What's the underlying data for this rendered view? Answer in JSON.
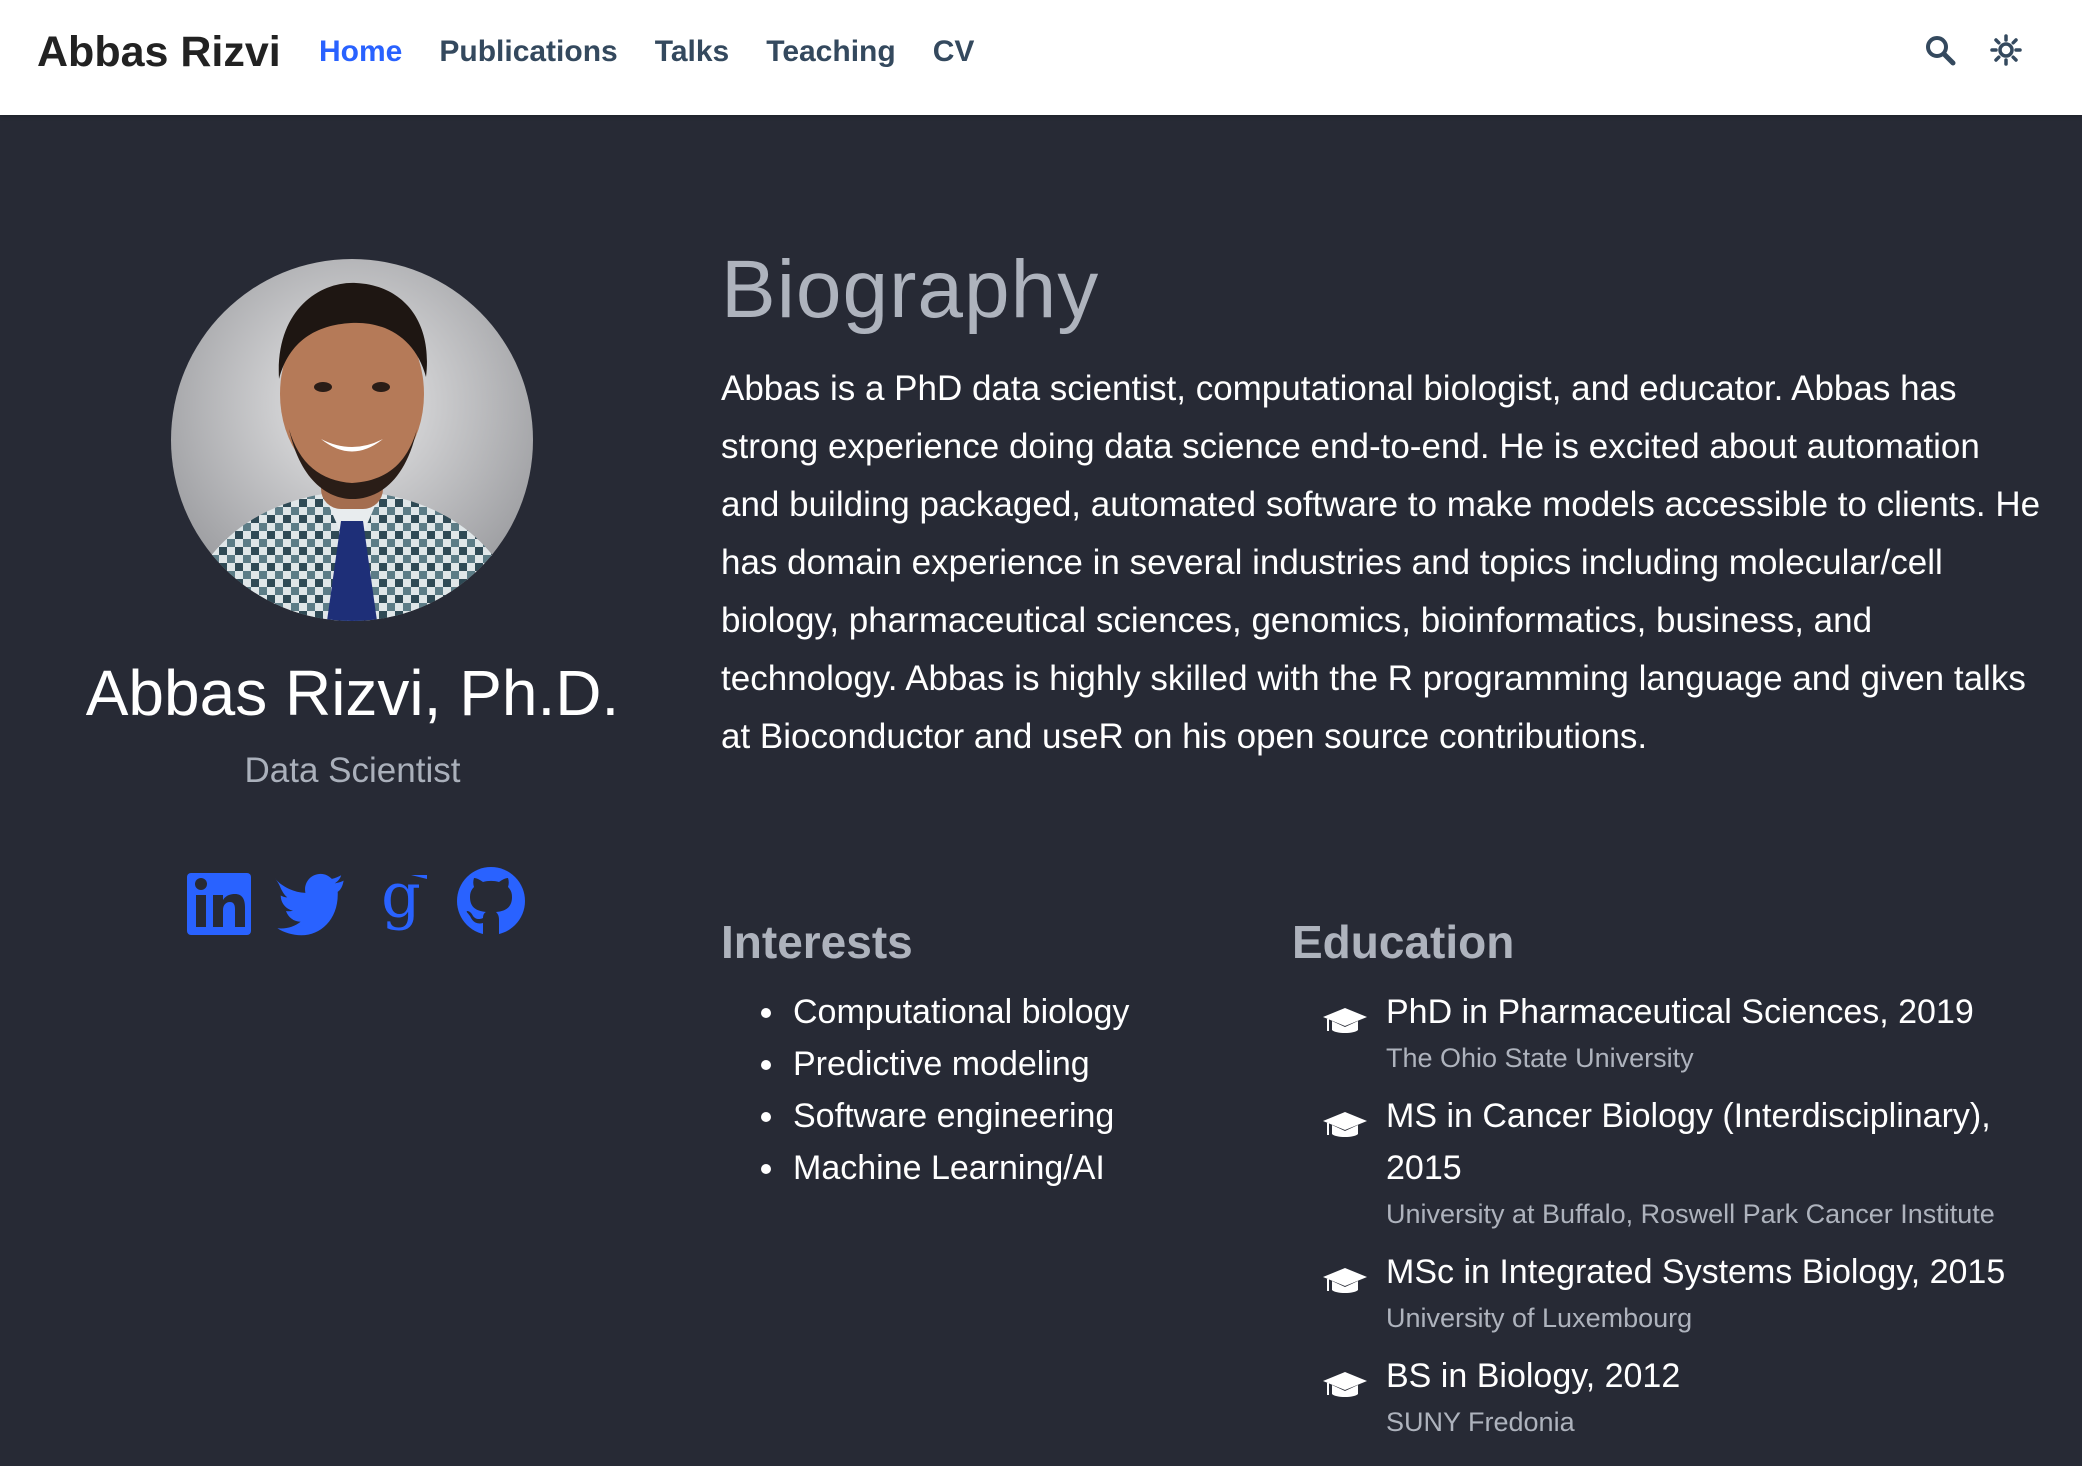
{
  "nav": {
    "brand": "Abbas Rizvi",
    "links": [
      {
        "label": "Home",
        "active": true
      },
      {
        "label": "Publications",
        "active": false
      },
      {
        "label": "Talks",
        "active": false
      },
      {
        "label": "Teaching",
        "active": false
      },
      {
        "label": "CV",
        "active": false
      }
    ],
    "icons": [
      "search-icon",
      "theme-toggle-icon"
    ],
    "active_color": "#2962ff"
  },
  "profile": {
    "name": "Abbas Rizvi, Ph.D.",
    "role": "Data Scientist",
    "socials": [
      "linkedin-icon",
      "twitter-icon",
      "google-scholar-icon",
      "github-icon"
    ],
    "social_color": "#2962ff"
  },
  "biography": {
    "title": "Biography",
    "text": "Abbas is a PhD data scientist, computational biologist, and educator. Abbas has strong experience doing data science end-to-end. He is excited about automation and building packaged, automated software to make models accessible to clients. He has domain experience in several industries and topics including molecular/cell biology, pharmaceutical sciences, genomics, bioinformatics, business, and technology. Abbas is highly skilled with the R programming language and given talks at Bioconductor and useR on his open source contributions."
  },
  "interests": {
    "title": "Interests",
    "items": [
      "Computational biology",
      "Predictive modeling",
      "Software engineering",
      "Machine Learning/AI"
    ]
  },
  "education": {
    "title": "Education",
    "items": [
      {
        "degree": "PhD in Pharmaceutical Sciences, 2019",
        "institution": "The Ohio State University"
      },
      {
        "degree": "MS in Cancer Biology (Interdisciplinary), 2015",
        "institution": "University at Buffalo, Roswell Park Cancer Institute"
      },
      {
        "degree": "MSc in Integrated Systems Biology, 2015",
        "institution": "University of Luxembourg"
      },
      {
        "degree": "BS in Biology, 2012",
        "institution": "SUNY Fredonia"
      }
    ]
  },
  "colors": {
    "background": "#272a35",
    "navbar": "#ffffff",
    "muted": "#aeb3bd"
  }
}
